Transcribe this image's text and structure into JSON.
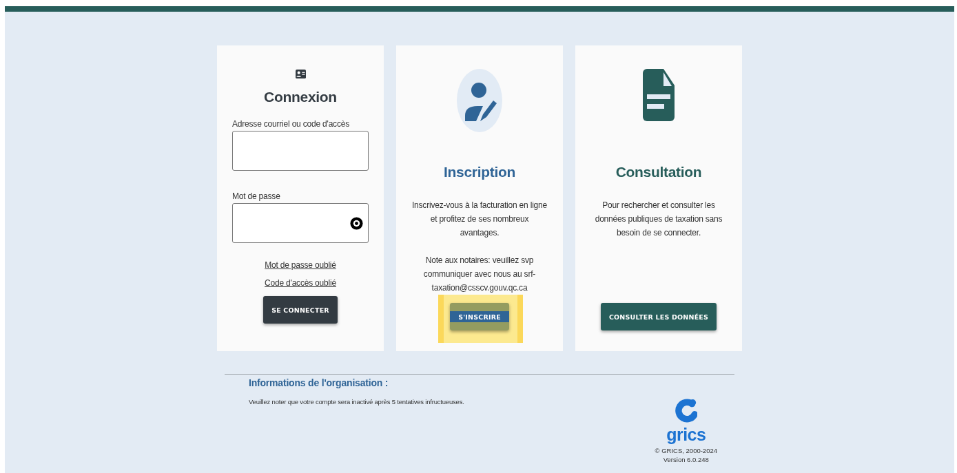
{
  "login": {
    "title": "Connexion",
    "fields": [
      {
        "label": "Adresse courriel ou code d'accès",
        "kind": "text"
      },
      {
        "label": "Mot de passe",
        "kind": "password"
      }
    ],
    "links": [
      "Mot de passe oublié",
      "Code d'accès oublié"
    ],
    "button": "SE CONNECTER"
  },
  "signup": {
    "title": "Inscription",
    "paragraphs": [
      "Inscrivez-vous à la facturation en ligne et profitez de ses nombreux avantages.",
      "Note aux notaires: veuillez svp communiquer avec nous au srf-taxation@csscv.gouv.qc.ca"
    ],
    "button": "S'INSCRIRE",
    "highlighted": true
  },
  "consultation": {
    "title": "Consultation",
    "paragraphs": [
      "Pour rechercher et consulter les données publiques de taxation sans besoin de se connecter."
    ],
    "button": "CONSULTER LES DONNÉES"
  },
  "org_info": {
    "title": "Informations de l'organisation :",
    "notice": "Veuillez noter que votre compte sera inactivé après 5 tentatives infructueuses."
  },
  "footer": {
    "logo_text": "grics",
    "copyright": "© GRICS, 2000-2024",
    "version": "Version 6.0.248"
  }
}
